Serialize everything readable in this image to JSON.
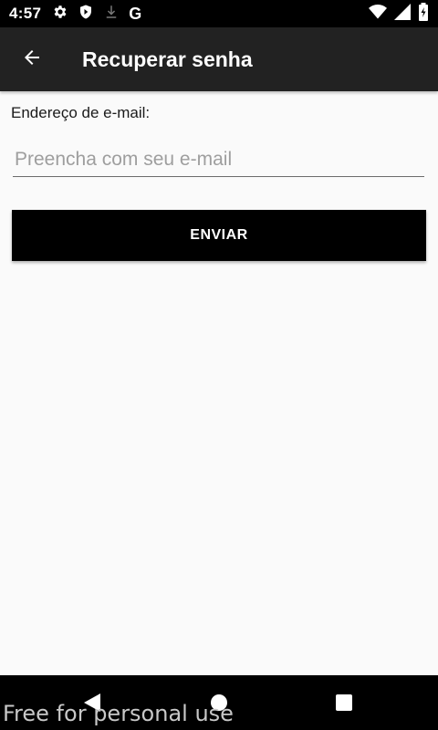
{
  "status_bar": {
    "time": "4:57",
    "left_icons": [
      "gear-icon",
      "shield-icon",
      "download-icon",
      "google-icon"
    ],
    "google_letter": "G",
    "right_icons": [
      "wifi-icon",
      "signal-icon",
      "battery-icon"
    ]
  },
  "app_bar": {
    "title": "Recuperar senha",
    "back_icon": "arrow-left-icon"
  },
  "form": {
    "email_label": "Endereço de e-mail:",
    "email_value": "",
    "email_placeholder": "Preencha com seu e-mail",
    "submit_label": "ENVIAR"
  },
  "nav_bar": {
    "buttons": [
      "back-triangle-icon",
      "home-circle-icon",
      "recents-square-icon"
    ]
  },
  "watermark": "Free for personal use",
  "colors": {
    "app_bar": "#222222",
    "background": "#fafafa",
    "button": "#000000",
    "button_text": "#ffffff"
  }
}
